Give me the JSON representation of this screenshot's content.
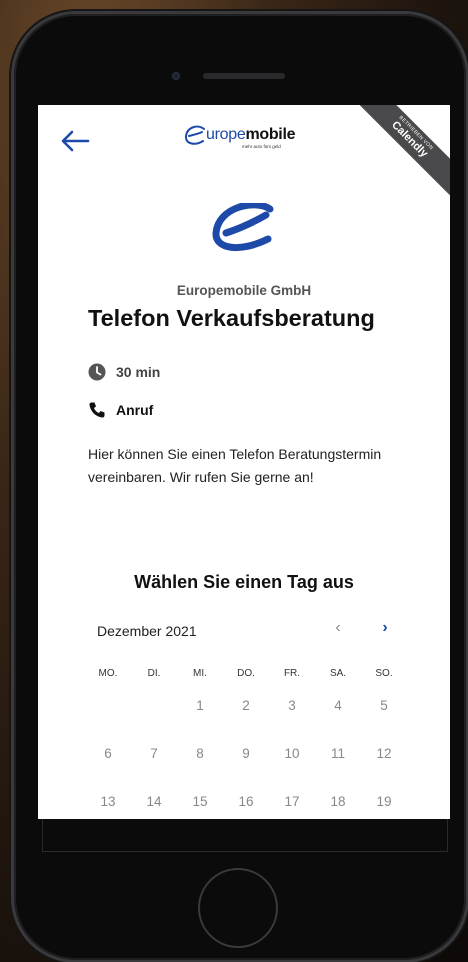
{
  "header": {
    "back_icon": "arrow-left-icon"
  },
  "brand": {
    "name_prefix": "urope",
    "name_suffix": "mobile",
    "tagline": "mehr auto fürs geld"
  },
  "ribbon": {
    "line1": "BETRIEBEN VON",
    "line2": "Calendly"
  },
  "colors": {
    "accent": "#1d4aa8",
    "ribbon": "#4a4a4c"
  },
  "event": {
    "company": "Europemobile GmbH",
    "title": "Telefon Verkaufsberatung",
    "duration": "30 min",
    "duration_icon": "clock-icon",
    "location": "Anruf",
    "location_icon": "phone-icon",
    "description": "Hier können Sie einen Telefon Beratungstermin vereinbaren. Wir rufen Sie gerne an!"
  },
  "calendar": {
    "heading": "Wählen Sie einen Tag aus",
    "month": "Dezember 2021",
    "prev": "‹",
    "next": "›",
    "weekdays": [
      "MO.",
      "DI.",
      "MI.",
      "DO.",
      "FR.",
      "SA.",
      "SO."
    ],
    "weeks": [
      [
        "",
        "",
        "1",
        "2",
        "3",
        "4",
        "5"
      ],
      [
        "6",
        "7",
        "8",
        "9",
        "10",
        "11",
        "12"
      ],
      [
        "13",
        "14",
        "15",
        "16",
        "17",
        "18",
        "19"
      ]
    ]
  }
}
